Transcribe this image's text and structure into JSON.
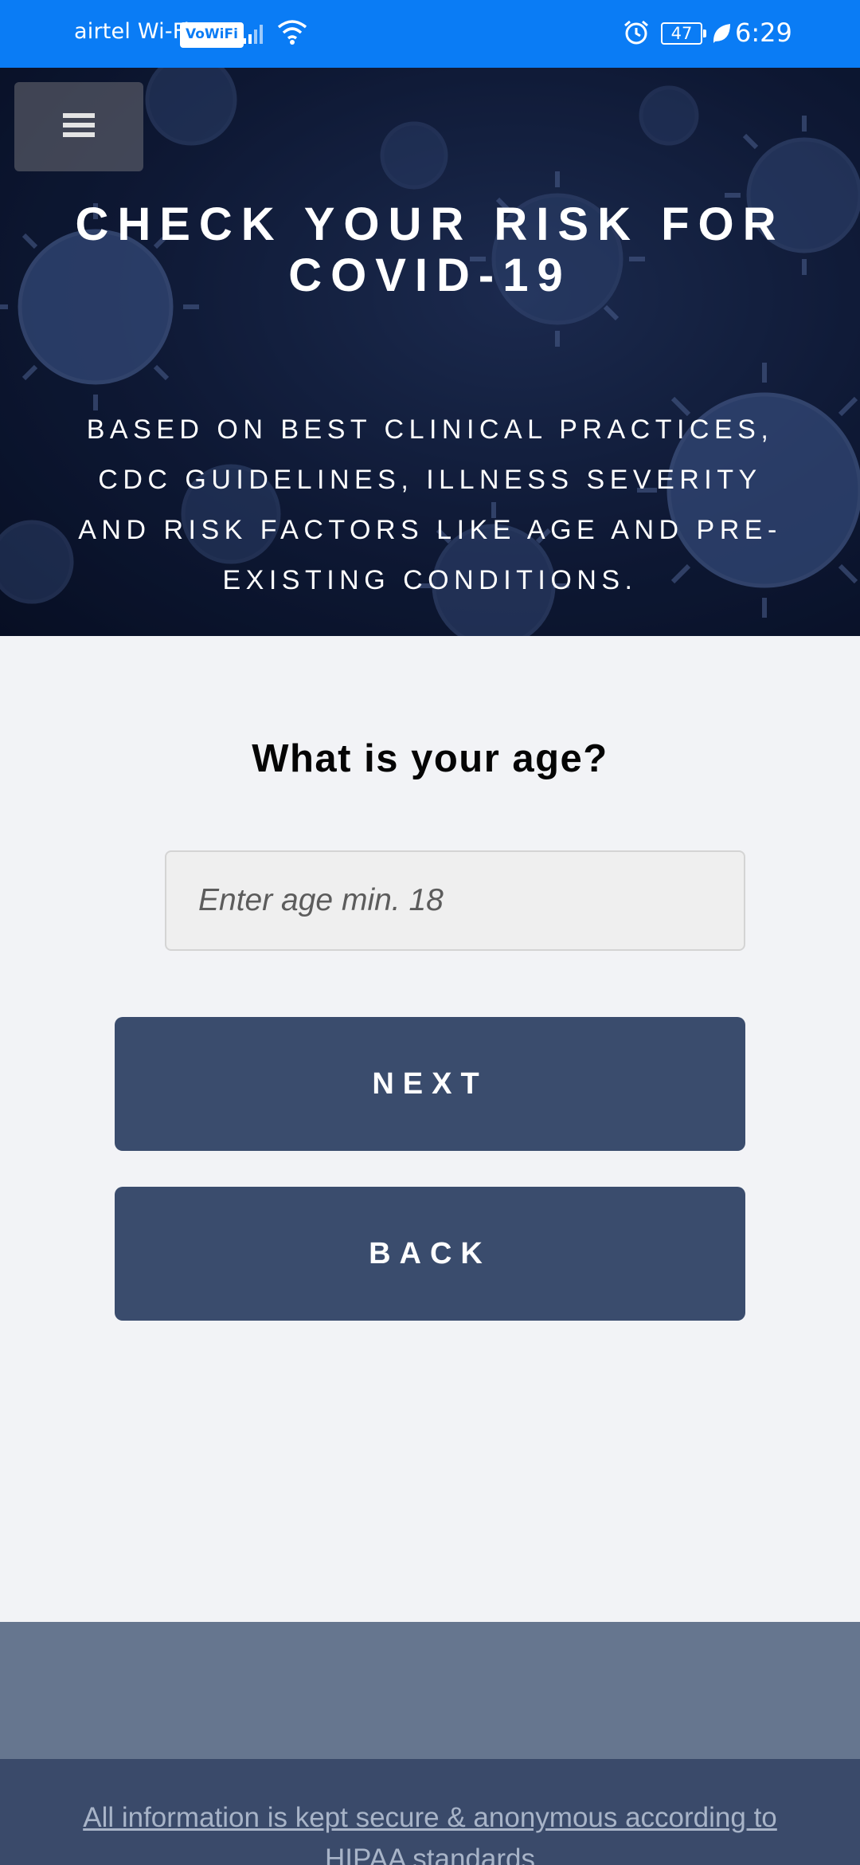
{
  "status_bar": {
    "carrier": "airtel Wi-Fi",
    "vowifi_badge": "VoWiFi",
    "battery_level": "47",
    "time": "6:29",
    "icons": [
      "signal-icon",
      "wifi-icon",
      "alarm-icon",
      "battery-icon",
      "leaf-icon"
    ]
  },
  "header": {
    "menu_icon": "hamburger-icon",
    "title": "CHECK YOUR RISK FOR COVID-19",
    "subtitle": "BASED ON BEST CLINICAL PRACTICES, CDC GUIDELINES, ILLNESS SEVERITY AND RISK FACTORS LIKE AGE AND PRE-EXISTING CONDITIONS."
  },
  "form": {
    "question": "What is your age?",
    "age_input": {
      "value": "",
      "placeholder": "Enter age min. 18"
    },
    "next_label": "NEXT",
    "back_label": "BACK"
  },
  "footer": {
    "privacy_text": "All information is kept secure & anonymous according to HIPAA standards"
  },
  "colors": {
    "status_bar": "#0a7cf5",
    "button": "#3a4c6d",
    "page_bg": "#f2f3f6",
    "footer_top": "#66768f",
    "footer_bottom": "#3a4a6a"
  }
}
